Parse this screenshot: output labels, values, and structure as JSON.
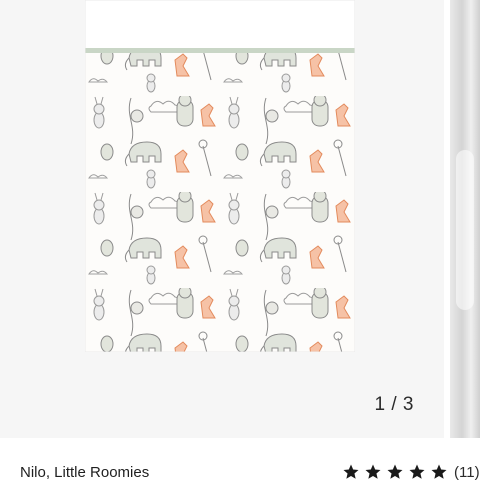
{
  "gallery": {
    "counter": "1 / 3",
    "image_icon": "printed-blanket-animals",
    "colors": {
      "panel": "#f6f6f6",
      "blanket": "#fdfcfa",
      "trim": "#c9d6c6"
    }
  },
  "product": {
    "title": "Nilo, Little Roomies",
    "rating": 5,
    "review_count": "(11)",
    "star_color": "#1a1a1a"
  }
}
